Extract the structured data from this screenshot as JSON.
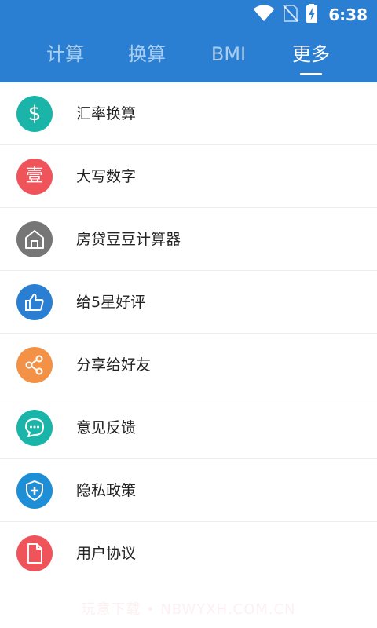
{
  "status_bar": {
    "time": "6:38",
    "icons": [
      "wifi-icon",
      "no-sim-icon",
      "battery-charging-icon"
    ]
  },
  "tabs": [
    {
      "label": "计算",
      "active": false
    },
    {
      "label": "换算",
      "active": false
    },
    {
      "label": "BMI",
      "active": false
    },
    {
      "label": "更多",
      "active": true
    }
  ],
  "menu": {
    "items": [
      {
        "label": "汇率换算",
        "icon": "dollar-icon",
        "color": "#1ab5a8",
        "glyph": "$"
      },
      {
        "label": "大写数字",
        "icon": "capital-number-icon",
        "color": "#f0545b",
        "glyph": "壹"
      },
      {
        "label": "房贷豆豆计算器",
        "icon": "house-icon",
        "color": "#767676",
        "glyph": ""
      },
      {
        "label": "给5星好评",
        "icon": "thumbs-up-icon",
        "color": "#2b7fd2",
        "glyph": ""
      },
      {
        "label": "分享给好友",
        "icon": "share-icon",
        "color": "#f39247",
        "glyph": ""
      },
      {
        "label": "意见反馈",
        "icon": "chat-bubble-icon",
        "color": "#1ab5a8",
        "glyph": ""
      },
      {
        "label": "隐私政策",
        "icon": "shield-icon",
        "color": "#1e8fd6",
        "glyph": ""
      },
      {
        "label": "用户协议",
        "icon": "document-icon",
        "color": "#f0545b",
        "glyph": ""
      }
    ]
  },
  "colors": {
    "header": "#2b7fd2",
    "tab_active": "#ffffff",
    "text": "#222222",
    "divider": "#eeeeee"
  },
  "watermark": "玩意下载 • NBWYXH.COM.CN"
}
